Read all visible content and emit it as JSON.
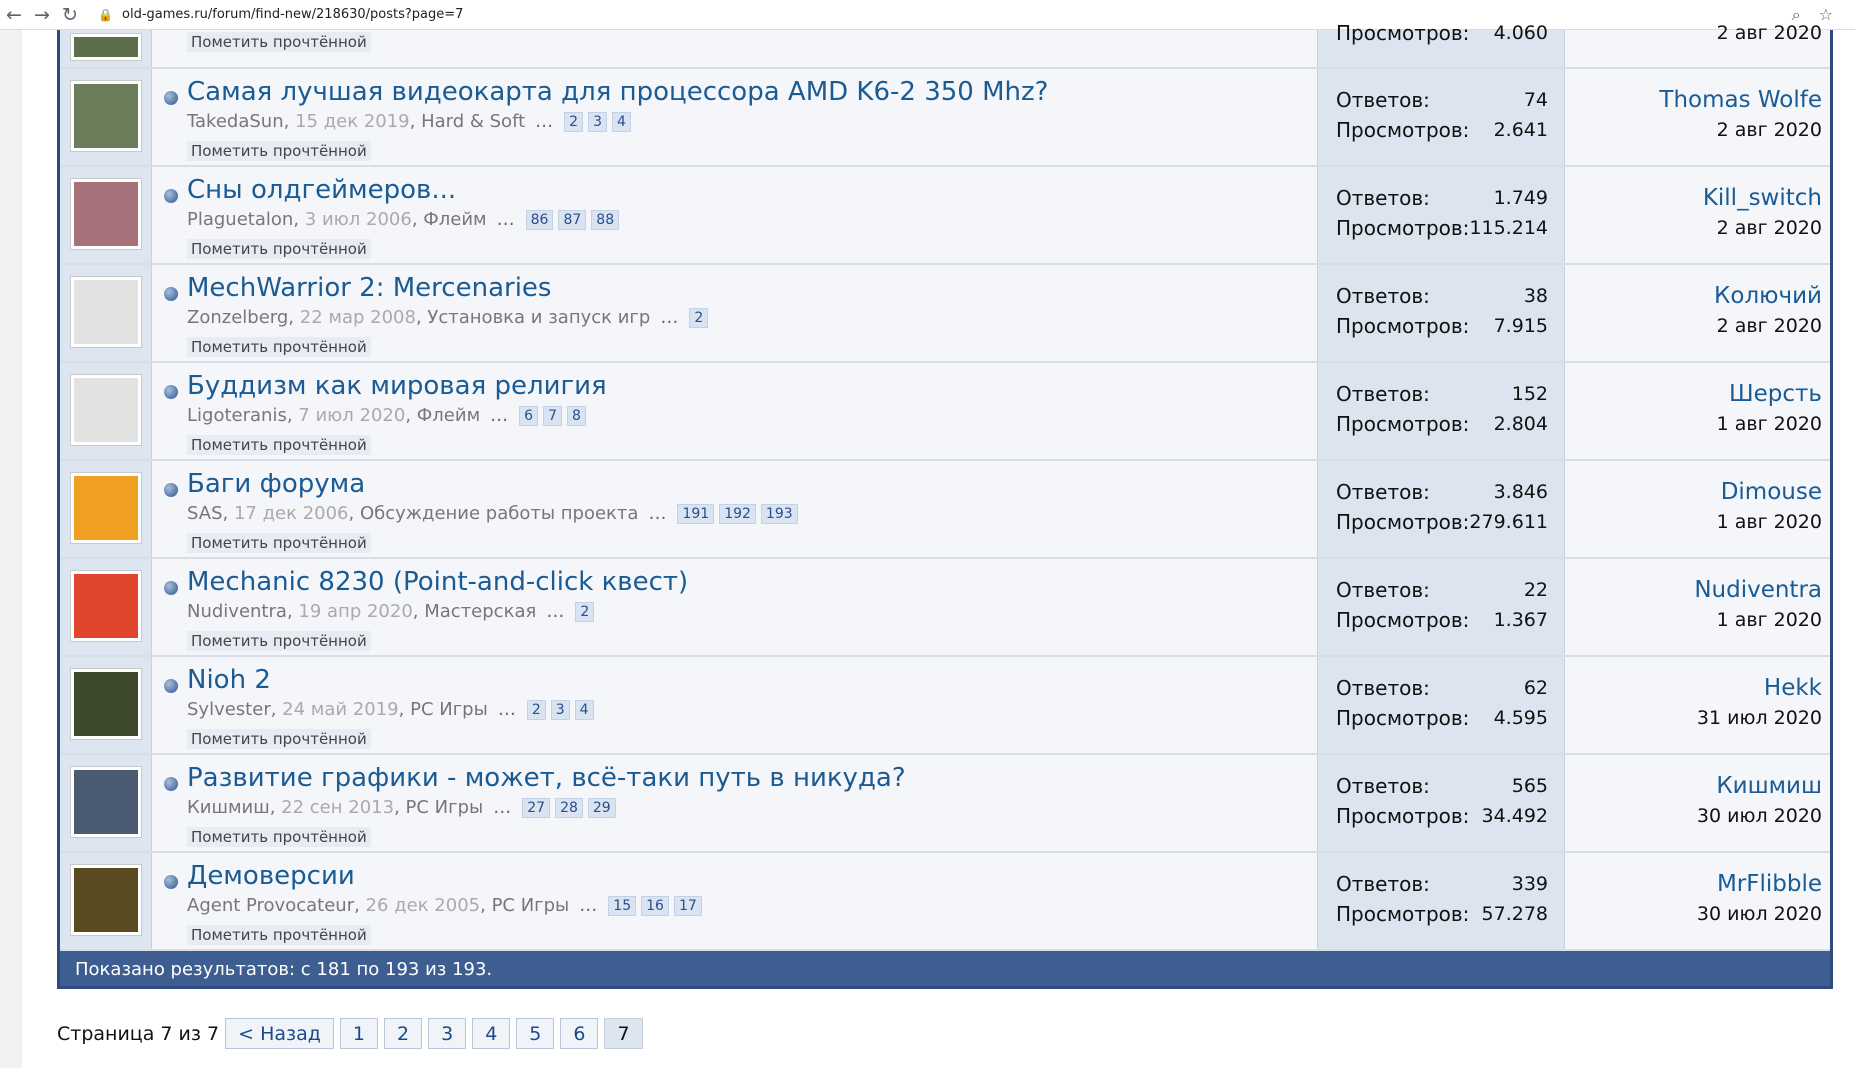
{
  "browser": {
    "url": "old-games.ru/forum/find-new/218630/posts?page=7"
  },
  "colors": {
    "accent": "#1b5b94",
    "header_bar": "#3e5e91",
    "border": "#2e4b7f"
  },
  "partial_row": {
    "mark_label": "Пометить прочтённой",
    "stats_views_label": "Просмотров:",
    "stats_views": "4.060",
    "last_date": "2 авг 2020"
  },
  "threads": [
    {
      "title": "Самая лучшая видеокарта для процессора AMD K6-2 350 Mhz?",
      "author": "TakedaSun",
      "date": "15 дек 2019",
      "forum": "Hard & Soft",
      "pages": [
        "2",
        "3",
        "4"
      ],
      "mark_label": "Пометить прочтённой",
      "replies_label": "Ответов:",
      "replies": "74",
      "views_label": "Просмотров:",
      "views": "2.641",
      "last_user": "Thomas Wolfe",
      "last_date": "2 авг 2020",
      "avatar_color": "#6b7d5a",
      "avatar_icon": "person-photo-icon"
    },
    {
      "title": "Сны олдгеймеров...",
      "author": "Plaguetalon",
      "date": "3 июл 2006",
      "forum": "Флейм",
      "pages": [
        "86",
        "87",
        "88"
      ],
      "mark_label": "Пометить прочтённой",
      "replies_label": "Ответов:",
      "replies": "1.749",
      "views_label": "Просмотров:",
      "views": "115.214",
      "last_user": "Kill_switch",
      "last_date": "2 авг 2020",
      "avatar_color": "#a5727a",
      "avatar_icon": "anime-face-icon"
    },
    {
      "title": "MechWarrior 2: Mercenaries",
      "author": "Zonzelberg",
      "date": "22 мар 2008",
      "forum": "Установка и запуск игр",
      "pages": [
        "2"
      ],
      "mark_label": "Пометить прочтённой",
      "replies_label": "Ответов:",
      "replies": "38",
      "views_label": "Просмотров:",
      "views": "7.915",
      "last_user": "Колючий",
      "last_date": "2 авг 2020",
      "avatar_color": "#e2e2e2",
      "avatar_icon": "default-avatar-icon"
    },
    {
      "title": "Буддизм как мировая религия",
      "author": "Ligoteranis",
      "date": "7 июл 2020",
      "forum": "Флейм",
      "pages": [
        "6",
        "7",
        "8"
      ],
      "mark_label": "Пометить прочтённой",
      "replies_label": "Ответов:",
      "replies": "152",
      "views_label": "Просмотров:",
      "views": "2.804",
      "last_user": "Шерсть",
      "last_date": "1 авг 2020",
      "avatar_color": "#e2e2e2",
      "avatar_icon": "male-symbol-icon"
    },
    {
      "title": "Баги форума",
      "author": "SAS",
      "date": "17 дек 2006",
      "forum": "Обсуждение работы проекта",
      "pages": [
        "191",
        "192",
        "193"
      ],
      "mark_label": "Пометить прочтённой",
      "replies_label": "Ответов:",
      "replies": "3.846",
      "views_label": "Просмотров:",
      "views": "279.611",
      "last_user": "Dimouse",
      "last_date": "1 авг 2020",
      "avatar_color": "#f0a020",
      "avatar_icon": "sun-face-icon"
    },
    {
      "title": "Mechanic 8230 (Point-and-click квест)",
      "author": "Nudiventra",
      "date": "19 апр 2020",
      "forum": "Мастерская",
      "pages": [
        "2"
      ],
      "mark_label": "Пометить прочтённой",
      "replies_label": "Ответов:",
      "replies": "22",
      "views_label": "Просмотров:",
      "views": "1.367",
      "last_user": "Nudiventra",
      "last_date": "1 авг 2020",
      "avatar_color": "#e0452e",
      "avatar_icon": "red-logo-icon"
    },
    {
      "title": "Nioh 2",
      "author": "Sylvester",
      "date": "24 май 2019",
      "forum": "PC Игры",
      "pages": [
        "2",
        "3",
        "4"
      ],
      "mark_label": "Пометить прочтённой",
      "replies_label": "Ответов:",
      "replies": "62",
      "views_label": "Просмотров:",
      "views": "4.595",
      "last_user": "Hekk",
      "last_date": "31 июл 2020",
      "avatar_color": "#3d4a2c",
      "avatar_icon": "character-photo-icon"
    },
    {
      "title": "Развитие графики - может, всё-таки путь в никуда?",
      "author": "Кишмиш",
      "date": "22 сен 2013",
      "forum": "PC Игры",
      "pages": [
        "27",
        "28",
        "29"
      ],
      "mark_label": "Пометить прочтённой",
      "replies_label": "Ответов:",
      "replies": "565",
      "views_label": "Просмотров:",
      "views": "34.492",
      "last_user": "Кишмиш",
      "last_date": "30 июл 2020",
      "avatar_color": "#4a5b72",
      "avatar_icon": "poster-photo-icon"
    },
    {
      "title": "Демоверсии",
      "author": "Agent Provocateur",
      "date": "26 дек 2005",
      "forum": "PC Игры",
      "pages": [
        "15",
        "16",
        "17"
      ],
      "mark_label": "Пометить прочтённой",
      "replies_label": "Ответов:",
      "replies": "339",
      "views_label": "Просмотров:",
      "views": "57.278",
      "last_user": "MrFlibble",
      "last_date": "30 июл 2020",
      "avatar_color": "#5a4a22",
      "avatar_icon": "monster-photo-icon"
    }
  ],
  "footer": {
    "results_text": "Показано результатов: с 181 по 193 из 193."
  },
  "pagination": {
    "label": "Страница 7 из 7",
    "prev": "< Назад",
    "pages": [
      "1",
      "2",
      "3",
      "4",
      "5",
      "6",
      "7"
    ],
    "current": "7"
  }
}
